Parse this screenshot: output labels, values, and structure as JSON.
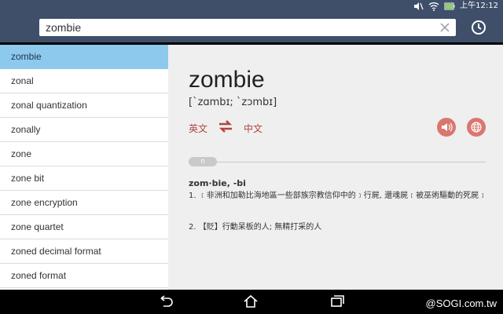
{
  "status": {
    "time": "上午12:12"
  },
  "search": {
    "value": "zombie"
  },
  "word_list": [
    "zombie",
    "zonal",
    "zonal quantization",
    "zonally",
    "zone",
    "zone bit",
    "zone encryption",
    "zone quartet",
    "zoned decimal format",
    "zoned format"
  ],
  "detail": {
    "headword": "zombie",
    "phonetic": "[ˋzɑmbɪ; ˋzɔmbɪ]",
    "lang_from": "英文",
    "lang_to": "中文",
    "pos": "n",
    "syllables": "zom·bie, -bi",
    "definitions": [
      "1. ﹝非洲和加勒比海地區一些部族宗教信仰中的﹞行屍, 還魂屍﹝被巫術驅動的死屍﹞",
      "2. 【貶】行動呆板的人; 無精打采的人"
    ]
  },
  "watermark": "@SOGI.com.tw",
  "colors": {
    "header": "#3f4f6a",
    "selected": "#8cc9ec",
    "accent": "#b0453d",
    "button": "#d9776f"
  }
}
